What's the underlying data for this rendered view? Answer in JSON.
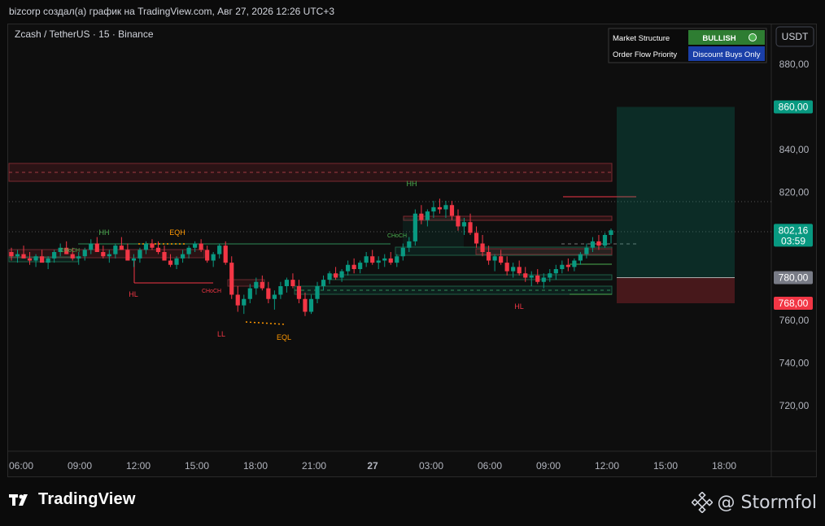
{
  "header": {
    "caption": "bizcorp создал(а) график на TradingView.com, Авг 27, 2026 12:26 UTC+3"
  },
  "symbol": {
    "title": "Zcash / TetherUS · 15 · Binance"
  },
  "currency_button": "USDT",
  "info_table": {
    "rows": [
      {
        "label": "Market Structure",
        "value": "BULLISH",
        "value_color": "#2e7d32"
      },
      {
        "label": "Order Flow Priority",
        "value": "Discount Buys Only",
        "value_color": "#1a3fa8"
      }
    ]
  },
  "price_axis": {
    "ticks": [
      "880,00",
      "860,00",
      "840,00",
      "820,00",
      "800,00",
      "780,00",
      "760,00",
      "740,00",
      "720,00"
    ],
    "tick_values": [
      880,
      860,
      840,
      820,
      800,
      780,
      760,
      740,
      720
    ],
    "labels": [
      {
        "value": 860,
        "text": "860,00",
        "color": "#089981"
      },
      {
        "value": 802.16,
        "text": "802,16",
        "sub": "03:59",
        "color": "#089981"
      },
      {
        "value": 780,
        "text": "780,00",
        "color": "#787b86"
      },
      {
        "value": 768,
        "text": "768,00",
        "color": "#f23645"
      }
    ]
  },
  "time_axis": {
    "labels": [
      "06:00",
      "09:00",
      "12:00",
      "15:00",
      "18:00",
      "21:00",
      "27",
      "03:00",
      "06:00",
      "09:00",
      "12:00",
      "15:00",
      "18:00"
    ]
  },
  "annotations": [
    {
      "text": "HH",
      "color": "#4caf50"
    },
    {
      "text": "EQH",
      "color": "#ff9800"
    },
    {
      "text": "HL",
      "color": "#f23645"
    },
    {
      "text": "LL",
      "color": "#f23645"
    },
    {
      "text": "EQL",
      "color": "#ff9800"
    },
    {
      "text": "HH",
      "color": "#4caf50"
    },
    {
      "text": "HL",
      "color": "#f23645"
    },
    {
      "text": "CHoCH",
      "color": "#4caf50"
    },
    {
      "text": "CHoCH",
      "color": "#f23645"
    },
    {
      "text": "CHoCH",
      "color": "#4caf50"
    }
  ],
  "chart_data": {
    "type": "candlestick",
    "title": "Zcash / TetherUS · 15 · Binance",
    "ylim": [
      700,
      890
    ],
    "x_labels": [
      "06:00",
      "09:00",
      "12:00",
      "15:00",
      "18:00",
      "21:00",
      "27",
      "03:00",
      "06:00",
      "09:00",
      "12:00",
      "15:00",
      "18:00"
    ],
    "up_color": "#089981",
    "down_color": "#f23645",
    "last_price": 802.16,
    "position": {
      "entry": 780,
      "target": 860,
      "stop": 768
    },
    "candles": [
      [
        792,
        794,
        788,
        790
      ],
      [
        790,
        793,
        787,
        791
      ],
      [
        791,
        795,
        789,
        789
      ],
      [
        789,
        792,
        786,
        788
      ],
      [
        788,
        791,
        785,
        790
      ],
      [
        790,
        793,
        788,
        787
      ],
      [
        787,
        790,
        784,
        789
      ],
      [
        789,
        793,
        787,
        792
      ],
      [
        792,
        796,
        790,
        794
      ],
      [
        794,
        797,
        791,
        791
      ],
      [
        791,
        794,
        788,
        789
      ],
      [
        789,
        792,
        786,
        790
      ],
      [
        790,
        794,
        788,
        793
      ],
      [
        793,
        798,
        791,
        796
      ],
      [
        796,
        799,
        792,
        792
      ],
      [
        792,
        795,
        789,
        790
      ],
      [
        790,
        793,
        787,
        791
      ],
      [
        791,
        796,
        789,
        795
      ],
      [
        795,
        799,
        793,
        793
      ],
      [
        793,
        796,
        790,
        788
      ],
      [
        788,
        791,
        785,
        789
      ],
      [
        789,
        794,
        787,
        793
      ],
      [
        793,
        797,
        791,
        796
      ],
      [
        796,
        798,
        793,
        794
      ],
      [
        794,
        797,
        791,
        792
      ],
      [
        792,
        795,
        788,
        788
      ],
      [
        788,
        791,
        785,
        786
      ],
      [
        786,
        790,
        784,
        789
      ],
      [
        789,
        793,
        787,
        791
      ],
      [
        791,
        795,
        789,
        794
      ],
      [
        794,
        797,
        792,
        796
      ],
      [
        796,
        798,
        792,
        793
      ],
      [
        793,
        795,
        787,
        788
      ],
      [
        788,
        792,
        785,
        791
      ],
      [
        791,
        796,
        789,
        795
      ],
      [
        795,
        797,
        786,
        787
      ],
      [
        787,
        790,
        770,
        772
      ],
      [
        772,
        776,
        764,
        767
      ],
      [
        767,
        772,
        763,
        770
      ],
      [
        770,
        777,
        768,
        775
      ],
      [
        775,
        780,
        772,
        778
      ],
      [
        778,
        781,
        774,
        775
      ],
      [
        775,
        778,
        768,
        770
      ],
      [
        770,
        774,
        765,
        772
      ],
      [
        772,
        778,
        770,
        776
      ],
      [
        776,
        780,
        773,
        779
      ],
      [
        779,
        782,
        775,
        776
      ],
      [
        776,
        779,
        768,
        770
      ],
      [
        770,
        773,
        762,
        764
      ],
      [
        764,
        772,
        763,
        770
      ],
      [
        770,
        778,
        768,
        776
      ],
      [
        776,
        781,
        774,
        779
      ],
      [
        779,
        783,
        777,
        782
      ],
      [
        782,
        785,
        779,
        780
      ],
      [
        780,
        784,
        778,
        783
      ],
      [
        783,
        788,
        781,
        786
      ],
      [
        786,
        789,
        782,
        784
      ],
      [
        784,
        788,
        782,
        787
      ],
      [
        787,
        792,
        785,
        790
      ],
      [
        790,
        793,
        786,
        787
      ],
      [
        787,
        790,
        784,
        788
      ],
      [
        788,
        791,
        785,
        789
      ],
      [
        789,
        792,
        786,
        787
      ],
      [
        787,
        791,
        785,
        790
      ],
      [
        790,
        796,
        788,
        794
      ],
      [
        794,
        799,
        792,
        797
      ],
      [
        797,
        812,
        795,
        810
      ],
      [
        810,
        814,
        805,
        807
      ],
      [
        807,
        812,
        804,
        811
      ],
      [
        811,
        816,
        808,
        813
      ],
      [
        813,
        817,
        810,
        812
      ],
      [
        812,
        816,
        808,
        814
      ],
      [
        814,
        816,
        807,
        809
      ],
      [
        809,
        812,
        802,
        804
      ],
      [
        804,
        808,
        800,
        806
      ],
      [
        806,
        810,
        800,
        801
      ],
      [
        801,
        804,
        794,
        796
      ],
      [
        796,
        800,
        790,
        792
      ],
      [
        792,
        795,
        786,
        788
      ],
      [
        788,
        791,
        783,
        790
      ],
      [
        790,
        793,
        786,
        787
      ],
      [
        787,
        790,
        781,
        783
      ],
      [
        783,
        787,
        780,
        785
      ],
      [
        785,
        788,
        781,
        782
      ],
      [
        782,
        785,
        778,
        780
      ],
      [
        780,
        783,
        776,
        781
      ],
      [
        781,
        784,
        777,
        778
      ],
      [
        778,
        782,
        775,
        780
      ],
      [
        780,
        784,
        778,
        782
      ],
      [
        782,
        786,
        779,
        784
      ],
      [
        784,
        788,
        782,
        786
      ],
      [
        786,
        789,
        783,
        785
      ],
      [
        785,
        789,
        783,
        788
      ],
      [
        788,
        792,
        786,
        791
      ],
      [
        791,
        796,
        789,
        794
      ],
      [
        794,
        799,
        792,
        797
      ],
      [
        797,
        800,
        793,
        795
      ],
      [
        795,
        801,
        794,
        800
      ],
      [
        800,
        803,
        796,
        802.16
      ]
    ]
  }
}
